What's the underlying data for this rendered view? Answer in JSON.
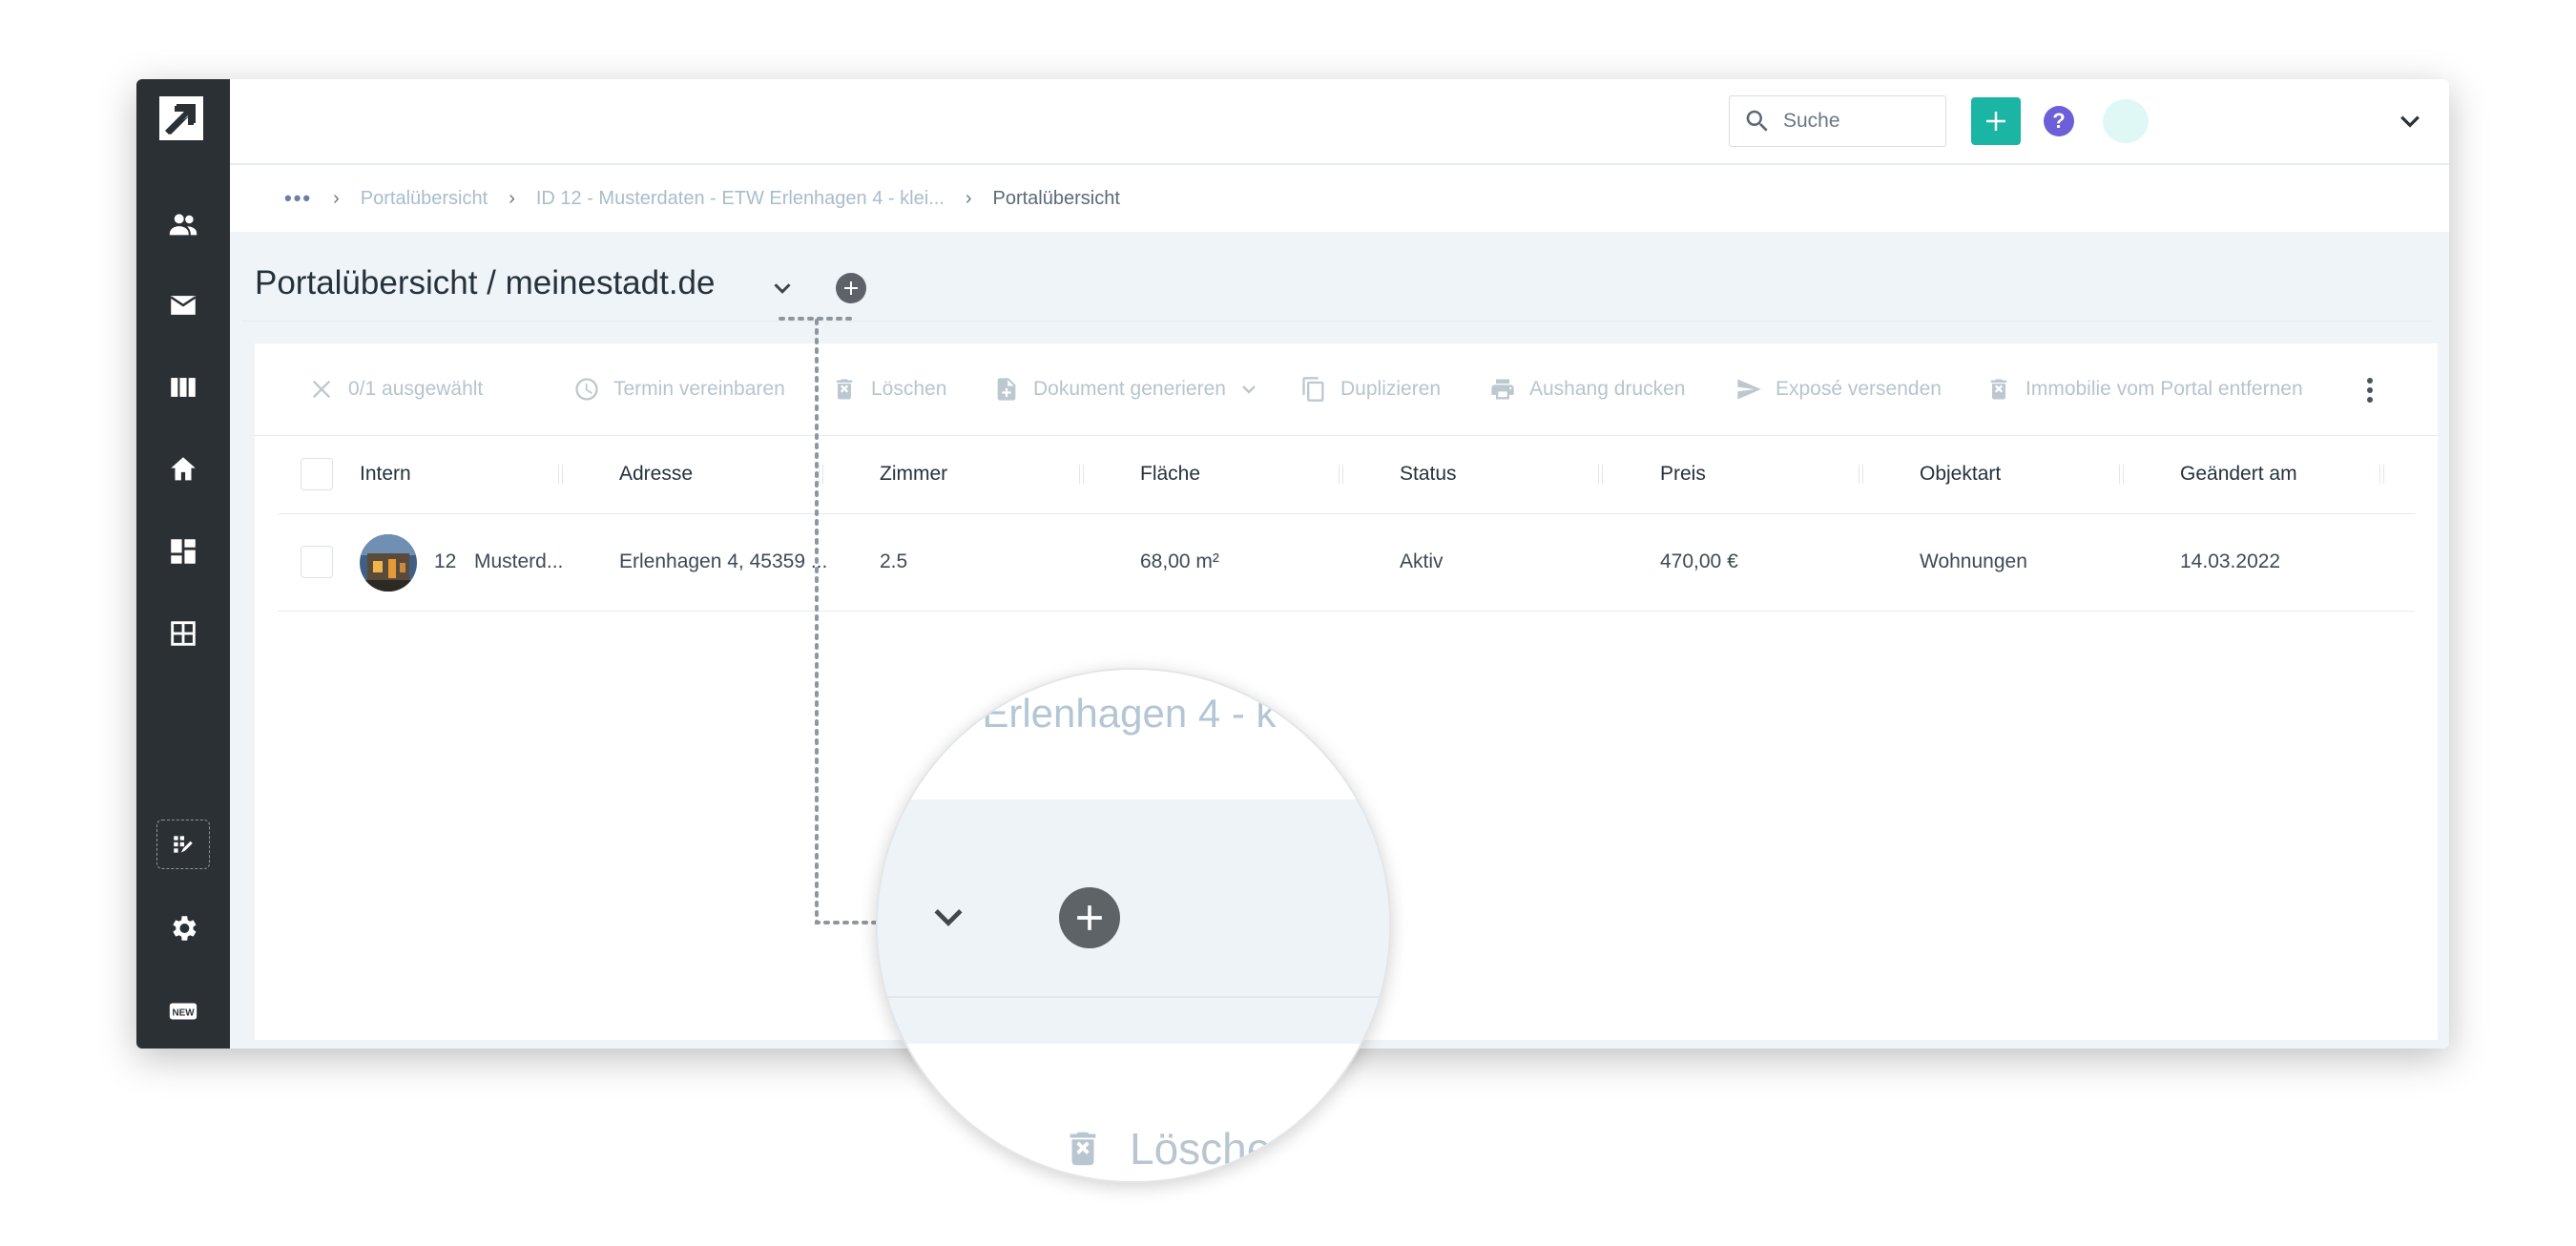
{
  "topbar": {
    "search_placeholder": "Suche"
  },
  "breadcrumb": {
    "items": [
      "Portalübersicht",
      "ID 12 - Musterdaten - ETW Erlenhagen 4 - klei..."
    ],
    "current": "Portalübersicht"
  },
  "page": {
    "title": "Portalübersicht / meinestadt.de"
  },
  "toolbar": {
    "selection": "0/1 ausgewählt",
    "termin": "Termin vereinbaren",
    "loeschen": "Löschen",
    "dokument": "Dokument generieren",
    "duplizieren": "Duplizieren",
    "aushang": "Aushang drucken",
    "expose": "Exposé versenden",
    "entfernen": "Immobilie vom Portal entfernen"
  },
  "table": {
    "columns": [
      "Intern",
      "Adresse",
      "Zimmer",
      "Fläche",
      "Status",
      "Preis",
      "Objektart",
      "Geändert am"
    ],
    "rows": [
      {
        "id": "12",
        "intern": "Musterd...",
        "adresse": "Erlenhagen 4, 45359 ...",
        "zimmer": "2.5",
        "flaeche": "68,00 m²",
        "status": "Aktiv",
        "preis": "470,00 €",
        "objektart": "Wohnungen",
        "geaendert": "14.03.2022"
      }
    ]
  },
  "magnifier": {
    "crumb_fragment": "/ Erlenhagen 4 - k",
    "delete_fragment": "Lösche"
  },
  "colors": {
    "sidebar": "#2b3035",
    "accent": "#1bb5a3",
    "help": "#6c5fd8",
    "content_bg": "#eff4f8"
  },
  "icons": {
    "sidebar": [
      "logo-arrow-icon",
      "contacts-icon",
      "mail-icon",
      "columns-icon",
      "home-icon",
      "dashboard-icon",
      "grid-icon",
      "edit-grid-icon",
      "gear-icon",
      "new-badge-icon"
    ]
  }
}
